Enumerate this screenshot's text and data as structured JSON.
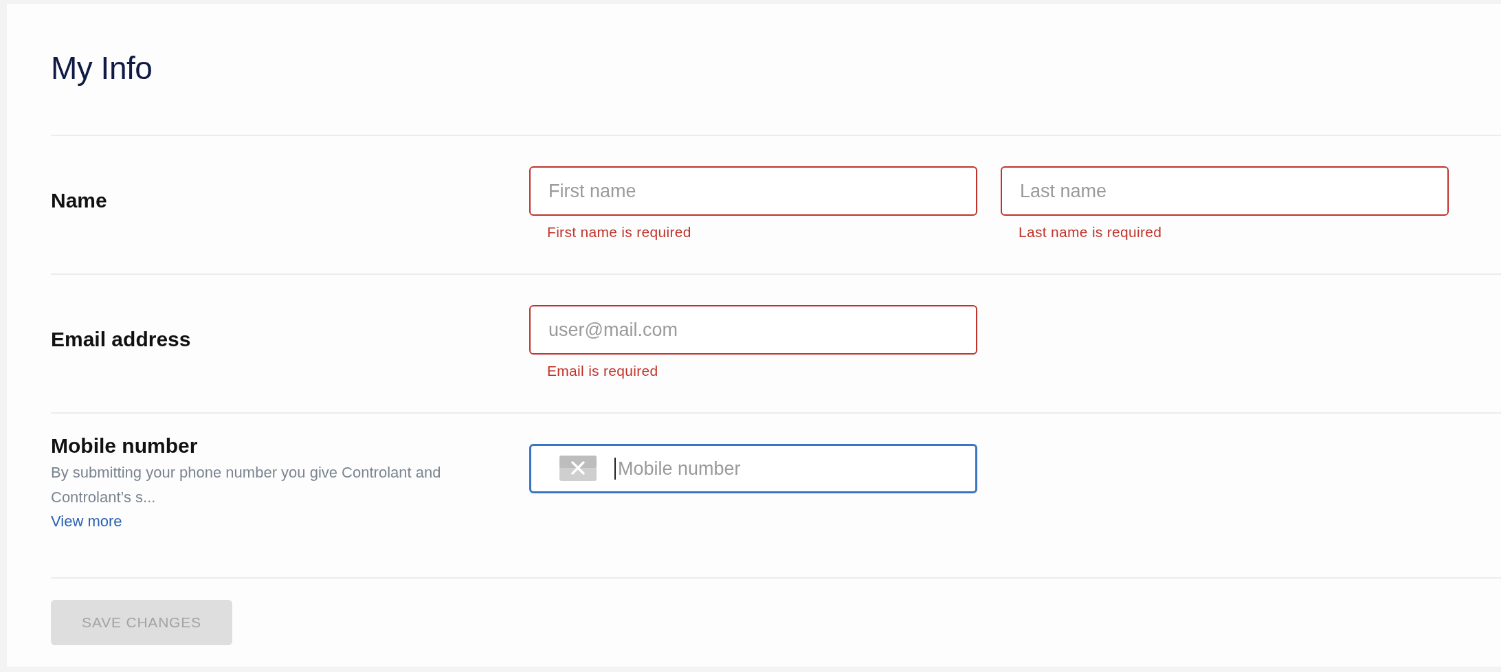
{
  "title": "My Info",
  "rows": [
    {
      "label": "Name",
      "fields": [
        {
          "kind": "text",
          "placeholder": "First name",
          "invalid": true,
          "focused": false,
          "error": "First name is required"
        },
        {
          "kind": "text",
          "placeholder": "Last name",
          "invalid": true,
          "focused": false,
          "error": "Last name is required"
        }
      ]
    },
    {
      "label": "Email address",
      "fields": [
        {
          "kind": "text",
          "placeholder": "user@mail.com",
          "invalid": true,
          "focused": false,
          "error": "Email is required"
        }
      ]
    },
    {
      "label": "Mobile number",
      "description": "By submitting your phone number you give Controlant and Controlant’s s...",
      "link": "View more",
      "fields": [
        {
          "kind": "phone",
          "placeholder": "Mobile number",
          "invalid": false,
          "focused": true
        }
      ]
    }
  ],
  "save_button": {
    "label": "SAVE CHANGES",
    "disabled": true
  }
}
